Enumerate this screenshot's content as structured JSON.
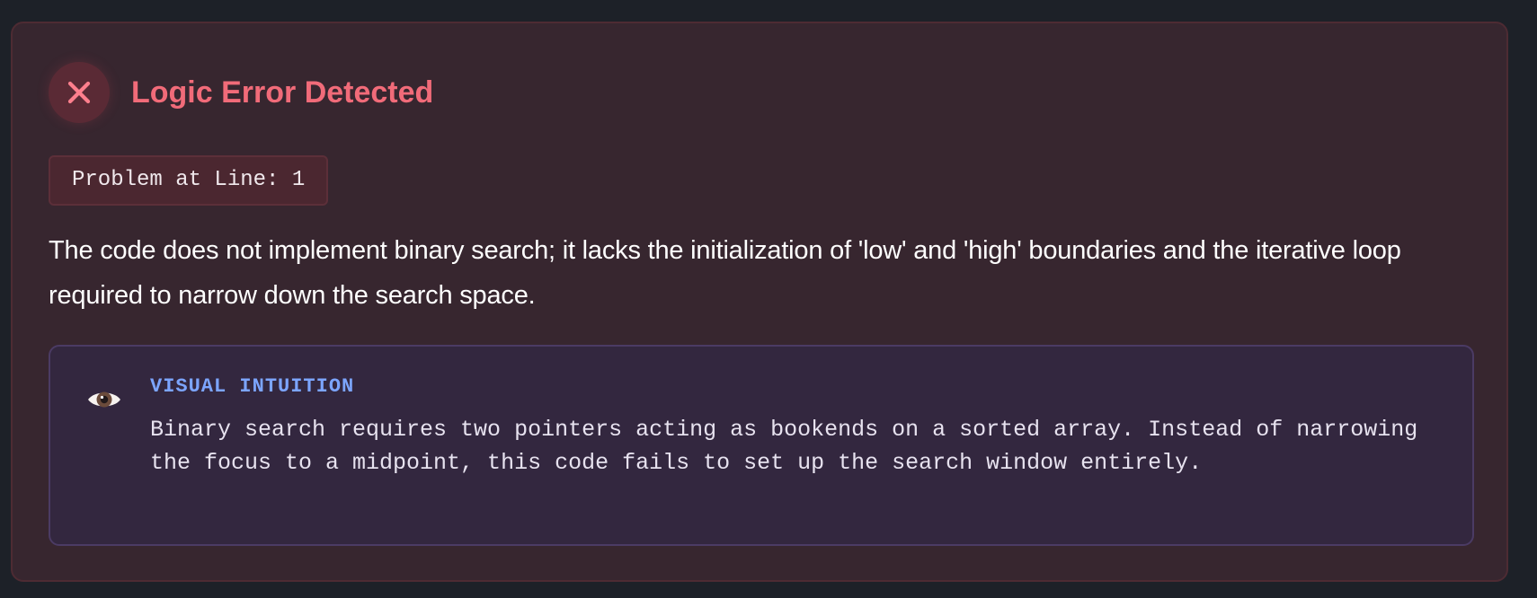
{
  "error": {
    "icon": "close-icon",
    "title": "Logic Error Detected",
    "line_label": "Problem at Line: 1",
    "description": "The code does not implement binary search; it lacks the initialization of 'low' and 'high' boundaries and the iterative loop required to narrow down the search space."
  },
  "visual_intuition": {
    "icon": "eye-icon",
    "label": "VISUAL INTUITION",
    "text": "Binary search requires two pointers acting as bookends on a sorted array. Instead of narrowing the focus to a midpoint, this code fails to set up the search window entirely."
  },
  "colors": {
    "page_background": "#1d2128",
    "error_panel": "#37262f",
    "error_accent": "#f16b79",
    "intuition_panel": "#33273f",
    "intuition_accent": "#7ca5ff"
  }
}
